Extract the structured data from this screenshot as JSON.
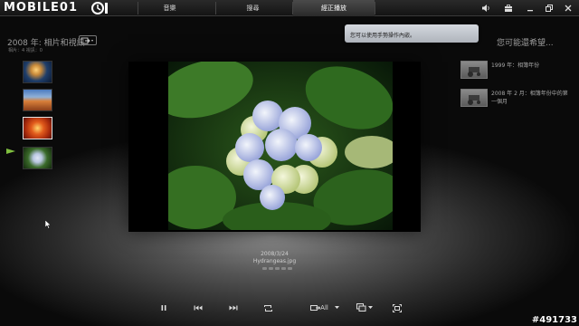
{
  "app": {
    "logo_text": "MOBILE01"
  },
  "nav": {
    "tabs": [
      {
        "label": "音樂"
      },
      {
        "label": "搜尋"
      },
      {
        "label": "經正播放"
      }
    ],
    "active_index": 2
  },
  "window_controls": [
    "volume-icon",
    "toolbox-icon",
    "minimize-icon",
    "restore-icon",
    "close-icon"
  ],
  "left_panel": {
    "title": "2008 年: 相片和視訊",
    "meta": "相片：4    視訊：0",
    "thumbnails": [
      {
        "name": "jellyfish",
        "selected": false
      },
      {
        "name": "desert",
        "selected": false
      },
      {
        "name": "chrysanthemum",
        "selected": true
      },
      {
        "name": "hydrangeas",
        "selected": false,
        "now_playing": true
      }
    ]
  },
  "viewer": {
    "date": "2008/3/24",
    "filename": "Hydrangeas.jpg",
    "rating_stars": 5
  },
  "tooltip": {
    "text": "您可以使用手勢操作內嵌。"
  },
  "suggestions": {
    "title": "您可能還希望...",
    "items": [
      {
        "text": "1999 年：相簿年份"
      },
      {
        "text": "2008 年 2 月：相簿年份中的第一個月"
      }
    ]
  },
  "controls": {
    "repeat_label": "All",
    "buttons": [
      "pause-icon",
      "previous-icon",
      "next-icon",
      "repeat-icon",
      "shuffle-icon",
      "slideshow-icon",
      "fullscreen-icon"
    ]
  },
  "watermark": "#491733",
  "colors": {
    "background": "#111111",
    "tooltip_bg": "#c4c8ce",
    "active_tab": "#3a3a3a"
  }
}
